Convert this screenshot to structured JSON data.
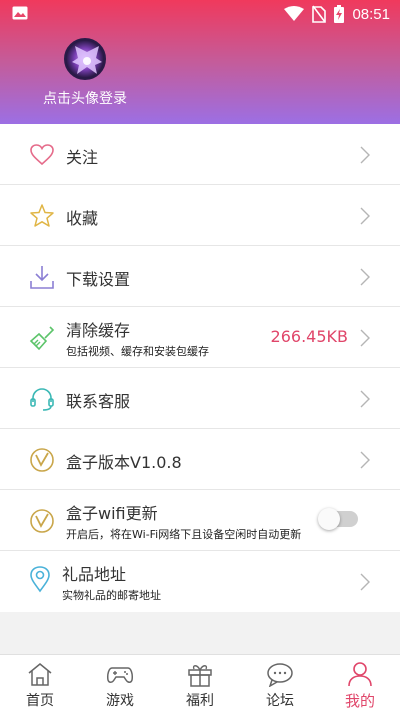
{
  "status_bar": {
    "time": "08:51"
  },
  "profile": {
    "login_prompt": "点击头像登录"
  },
  "menu": [
    {
      "id": "follow",
      "title": "关注",
      "icon": "heart-icon"
    },
    {
      "id": "favorites",
      "title": "收藏",
      "icon": "star-icon"
    },
    {
      "id": "download",
      "title": "下载设置",
      "icon": "download-icon"
    },
    {
      "id": "cache",
      "title": "清除缓存",
      "subtitle": "包括视频、缓存和安装包缓存",
      "value": "266.45KB",
      "icon": "broom-icon"
    },
    {
      "id": "support",
      "title": "联系客服",
      "icon": "headset-icon"
    },
    {
      "id": "version",
      "title": "盒子版本V1.0.8",
      "icon": "v-logo-icon"
    },
    {
      "id": "wifi-update",
      "title": "盒子wifi更新",
      "subtitle": "开启后，将在Wi-Fi网络下且设备空闲时自动更新",
      "icon": "v-logo-icon",
      "toggle_on": false
    },
    {
      "id": "gift-address",
      "title": "礼品地址",
      "subtitle": "实物礼品的邮寄地址",
      "icon": "location-pin-icon"
    }
  ],
  "bottom_nav": [
    {
      "label": "首页",
      "icon": "home-icon",
      "active": false
    },
    {
      "label": "游戏",
      "icon": "gamepad-icon",
      "active": false
    },
    {
      "label": "福利",
      "icon": "gift-icon",
      "active": false
    },
    {
      "label": "论坛",
      "icon": "chat-icon",
      "active": false
    },
    {
      "label": "我的",
      "icon": "person-icon",
      "active": true
    }
  ],
  "colors": {
    "accent": "#e0466a",
    "header_top": "#f0395c",
    "header_bottom": "#9c6fe4",
    "cache_icon": "#5cc46a",
    "support_icon": "#3bb8b5",
    "version_icon": "#c9a64a",
    "location_icon": "#4ab2d9"
  }
}
